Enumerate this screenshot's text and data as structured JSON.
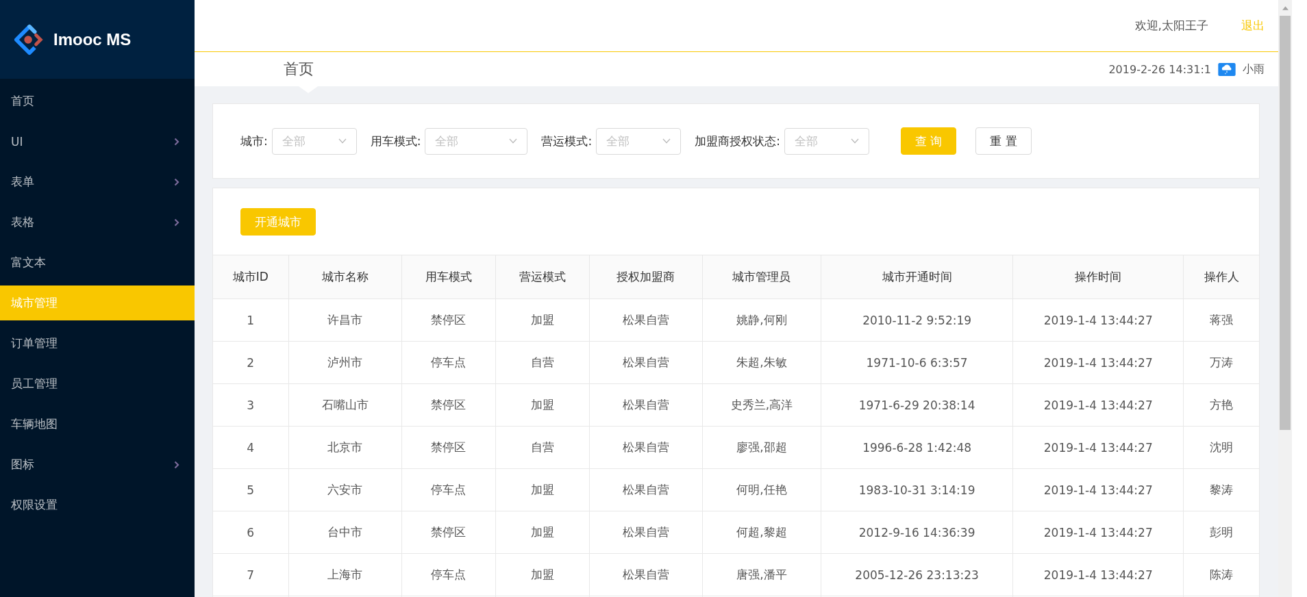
{
  "brand": {
    "name": "Imooc MS"
  },
  "sidebar": {
    "items": [
      {
        "label": "首页",
        "has_submenu": false,
        "selected": false
      },
      {
        "label": "UI",
        "has_submenu": true,
        "selected": false
      },
      {
        "label": "表单",
        "has_submenu": true,
        "selected": false
      },
      {
        "label": "表格",
        "has_submenu": true,
        "selected": false
      },
      {
        "label": "富文本",
        "has_submenu": false,
        "selected": false
      },
      {
        "label": "城市管理",
        "has_submenu": false,
        "selected": true
      },
      {
        "label": "订单管理",
        "has_submenu": false,
        "selected": false
      },
      {
        "label": "员工管理",
        "has_submenu": false,
        "selected": false
      },
      {
        "label": "车辆地图",
        "has_submenu": false,
        "selected": false
      },
      {
        "label": "图标",
        "has_submenu": true,
        "selected": false
      },
      {
        "label": "权限设置",
        "has_submenu": false,
        "selected": false
      }
    ]
  },
  "header": {
    "welcome": "欢迎,太阳王子",
    "logout": "退出",
    "breadcrumb": "首页",
    "datetime": "2019-2-26 14:31:1",
    "weather": "小雨"
  },
  "filters": [
    {
      "label": "城市:",
      "placeholder": "全部"
    },
    {
      "label": "用车模式:",
      "placeholder": "全部"
    },
    {
      "label": "营运模式:",
      "placeholder": "全部"
    },
    {
      "label": "加盟商授权状态:",
      "placeholder": "全部"
    }
  ],
  "filter_buttons": [
    {
      "label": "查 询",
      "kind": "primary"
    },
    {
      "label": "重 置",
      "kind": "default"
    }
  ],
  "open_city_button": "开通城市",
  "table": {
    "columns": [
      "城市ID",
      "城市名称",
      "用车模式",
      "营运模式",
      "授权加盟商",
      "城市管理员",
      "城市开通时间",
      "操作时间",
      "操作人"
    ],
    "rows": [
      [
        "1",
        "许昌市",
        "禁停区",
        "加盟",
        "松果自营",
        "姚静,何刚",
        "2010-11-2 9:52:19",
        "2019-1-4 13:44:27",
        "蒋强"
      ],
      [
        "2",
        "泸州市",
        "停车点",
        "自营",
        "松果自营",
        "朱超,朱敏",
        "1971-10-6 6:3:57",
        "2019-1-4 13:44:27",
        "万涛"
      ],
      [
        "3",
        "石嘴山市",
        "禁停区",
        "加盟",
        "松果自营",
        "史秀兰,高洋",
        "1971-6-29 20:38:14",
        "2019-1-4 13:44:27",
        "方艳"
      ],
      [
        "4",
        "北京市",
        "禁停区",
        "自营",
        "松果自营",
        "廖强,邵超",
        "1996-6-28 1:42:48",
        "2019-1-4 13:44:27",
        "沈明"
      ],
      [
        "5",
        "六安市",
        "停车点",
        "加盟",
        "松果自营",
        "何明,任艳",
        "1983-10-31 3:14:19",
        "2019-1-4 13:44:27",
        "黎涛"
      ],
      [
        "6",
        "台中市",
        "禁停区",
        "加盟",
        "松果自营",
        "何超,黎超",
        "2012-9-16 14:36:39",
        "2019-1-4 13:44:27",
        "彭明"
      ],
      [
        "7",
        "上海市",
        "停车点",
        "加盟",
        "松果自营",
        "唐强,潘平",
        "2005-12-26 23:13:23",
        "2019-1-4 13:44:27",
        "陈涛"
      ]
    ]
  }
}
